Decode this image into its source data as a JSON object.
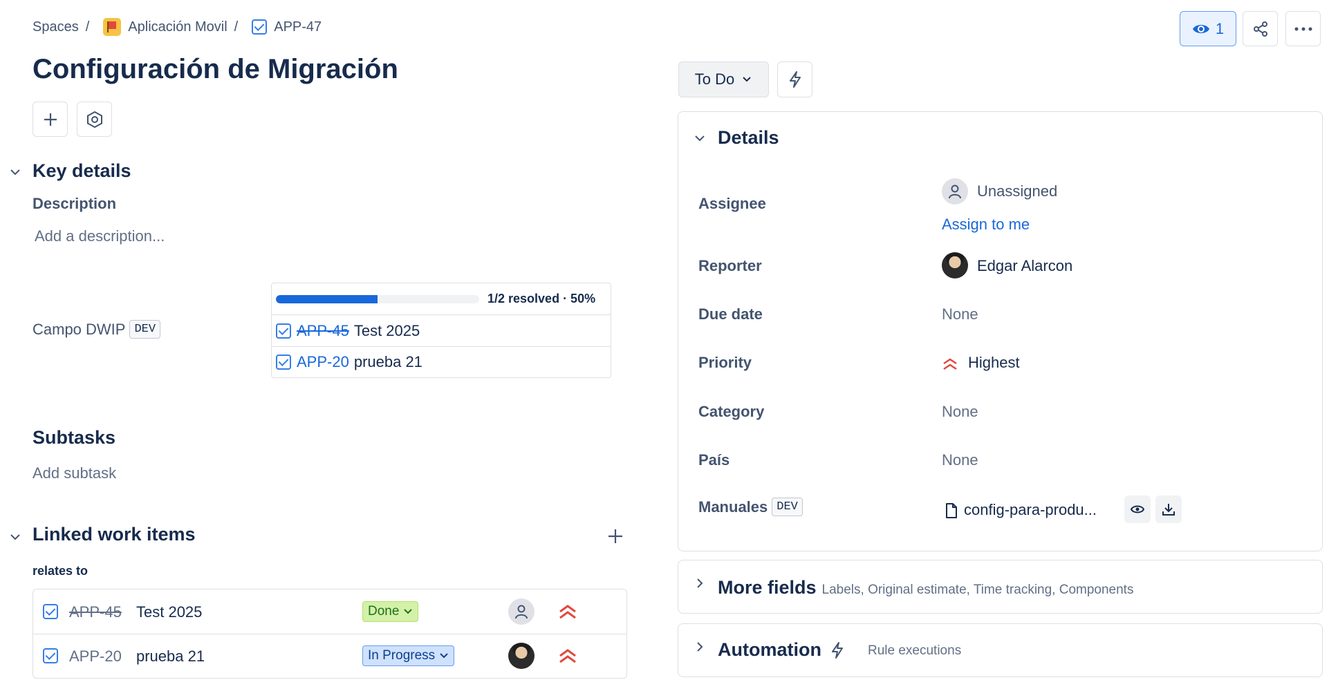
{
  "breadcrumb": {
    "spaces": "Spaces",
    "sep": "/",
    "project": "Aplicación Movil",
    "issue_key": "APP-47"
  },
  "header": {
    "watch_count": "1"
  },
  "issue": {
    "title": "Configuración de Migración"
  },
  "key_details": {
    "heading": "Key details",
    "description_label": "Description",
    "description_placeholder": "Add a description...",
    "campo_label": "Campo DWIP",
    "dev_badge": "DEV",
    "progress_text": "1/2 resolved · 50%",
    "progress_fraction": 0.5,
    "items": [
      {
        "key": "APP-45",
        "title": "Test 2025"
      },
      {
        "key": "APP-20",
        "title": "prueba 21"
      }
    ]
  },
  "subtasks": {
    "heading": "Subtasks",
    "add_label": "Add subtask"
  },
  "linked": {
    "heading": "Linked work items",
    "relation": "relates to",
    "rows": [
      {
        "key": "APP-45",
        "title": "Test 2025",
        "status": "Done"
      },
      {
        "key": "APP-20",
        "title": "prueba 21",
        "status": "In Progress"
      }
    ]
  },
  "status_button": {
    "label": "To Do"
  },
  "details": {
    "heading": "Details",
    "assignee_label": "Assignee",
    "assignee_value": "Unassigned",
    "assign_to_me": "Assign to me",
    "reporter_label": "Reporter",
    "reporter_value": "Edgar Alarcon",
    "due_label": "Due date",
    "due_value": "None",
    "priority_label": "Priority",
    "priority_value": "Highest",
    "category_label": "Category",
    "category_value": "None",
    "pais_label": "País",
    "pais_value": "None",
    "manuales_label": "Manuales",
    "manuales_badge": "DEV",
    "manuales_file": "config-para-produ..."
  },
  "more_fields": {
    "heading": "More fields",
    "subtitle": "Labels, Original estimate, Time tracking, Components"
  },
  "automation": {
    "heading": "Automation",
    "subtitle": "Rule executions"
  },
  "colors": {
    "accent": "#1868db",
    "done_bg": "#d3f1a7",
    "in_progress_bg": "#cfe1fd",
    "priority_red": "#e2483d"
  }
}
